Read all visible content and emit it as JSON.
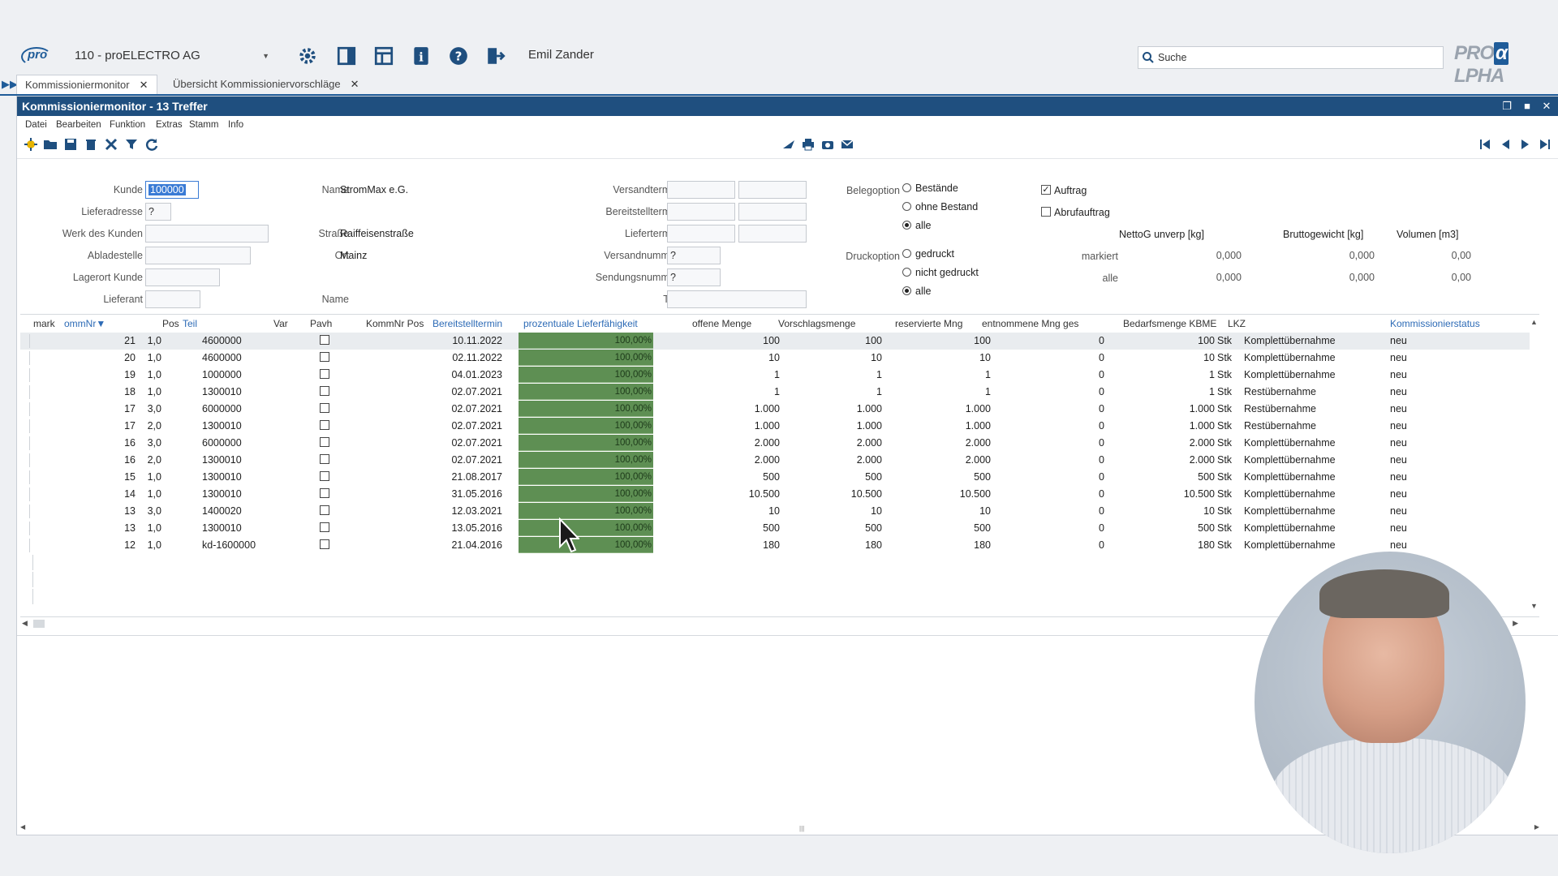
{
  "company": "110 - proELECTRO AG",
  "user": "Emil Zander",
  "search_placeholder": "Suche",
  "brand": {
    "pre": "PRO",
    "alpha": "α",
    "post": "LPHA"
  },
  "tabs": [
    {
      "label": "Kommissioniermonitor"
    },
    {
      "label": "Übersicht Kommissioniervorschläge"
    }
  ],
  "window_title": "Kommissioniermonitor - 13 Treffer",
  "menu": [
    "Datei",
    "Bearbeiten",
    "Funktion",
    "Extras",
    "Stamm",
    "Info"
  ],
  "form": {
    "kunde_label": "Kunde",
    "kunde_value": "100000",
    "lieferadresse_label": "Lieferadresse",
    "lieferadresse_value": "?",
    "werk_label": "Werk des Kunden",
    "abladestelle_label": "Abladestelle",
    "lagerort_label": "Lagerort Kunde",
    "lieferant_label": "Lieferant",
    "name_label": "Name",
    "name_value": "StromMax e.G.",
    "strasse_label": "Straße",
    "strasse_value": "Raiffeisenstraße",
    "ort_label": "Ort",
    "ort_value": "Mainz",
    "name2_label": "Name",
    "versandtermin_label": "Versandtermin",
    "bereitstelltermin_label": "Bereitstelltermin",
    "liefertermin_label": "Liefertermin",
    "versandnummer_label": "Versandnummer",
    "versandnummer_value": "?",
    "sendungsnummer_label": "Sendungsnummer",
    "sendungsnummer_value": "?",
    "teil_label": "Teil",
    "belegoption_label": "Belegoption",
    "belegoptions": [
      "Bestände",
      "ohne Bestand",
      "alle"
    ],
    "druckoption_label": "Druckoption",
    "druckoptions": [
      "gedruckt",
      "nicht gedruckt",
      "alle"
    ],
    "auftrag_label": "Auftrag",
    "abrufauftrag_label": "Abrufauftrag",
    "summary_headers": [
      "NettoG unverp [kg]",
      "Bruttogewicht [kg]",
      "Volumen [m3]"
    ],
    "summary_rows": [
      {
        "label": "markiert",
        "values": [
          "0,000",
          "0,000",
          "0,00"
        ]
      },
      {
        "label": "alle",
        "values": [
          "0,000",
          "0,000",
          "0,00"
        ]
      }
    ]
  },
  "table": {
    "headers": {
      "mark": "mark",
      "nr": "ommNr",
      "pos": "Pos",
      "teil": "Teil",
      "var": "Var",
      "pavh": "Pavh",
      "kommpos": "KommNr Pos",
      "bereit": "Bereitstelltermin",
      "liefer": "prozentuale Lieferfähigkeit",
      "offen": "offene Menge",
      "vorschlag": "Vorschlagsmenge",
      "reserviert": "reservierte Mng",
      "entnommen": "entnommene Mng ges",
      "bedarf": "Bedarfsmenge KBME",
      "lkz": "LKZ",
      "status": "Kommissionierstatus"
    },
    "rows": [
      {
        "nr": "21",
        "pos": "1,0",
        "teil": "4600000",
        "date": "10.11.2022",
        "pct": "100,00%",
        "offen": "100",
        "vor": "100",
        "res": "100",
        "ent": "0",
        "bed": "100",
        "unit": "Stk",
        "lkz": "Komplettübernahme",
        "status": "neu"
      },
      {
        "nr": "20",
        "pos": "1,0",
        "teil": "4600000",
        "date": "02.11.2022",
        "pct": "100,00%",
        "offen": "10",
        "vor": "10",
        "res": "10",
        "ent": "0",
        "bed": "10",
        "unit": "Stk",
        "lkz": "Komplettübernahme",
        "status": "neu"
      },
      {
        "nr": "19",
        "pos": "1,0",
        "teil": "1000000",
        "date": "04.01.2023",
        "pct": "100,00%",
        "offen": "1",
        "vor": "1",
        "res": "1",
        "ent": "0",
        "bed": "1",
        "unit": "Stk",
        "lkz": "Komplettübernahme",
        "status": "neu"
      },
      {
        "nr": "18",
        "pos": "1,0",
        "teil": "1300010",
        "date": "02.07.2021",
        "pct": "100,00%",
        "offen": "1",
        "vor": "1",
        "res": "1",
        "ent": "0",
        "bed": "1",
        "unit": "Stk",
        "lkz": "Restübernahme",
        "status": "neu"
      },
      {
        "nr": "17",
        "pos": "3,0",
        "teil": "6000000",
        "date": "02.07.2021",
        "pct": "100,00%",
        "offen": "1.000",
        "vor": "1.000",
        "res": "1.000",
        "ent": "0",
        "bed": "1.000",
        "unit": "Stk",
        "lkz": "Restübernahme",
        "status": "neu"
      },
      {
        "nr": "17",
        "pos": "2,0",
        "teil": "1300010",
        "date": "02.07.2021",
        "pct": "100,00%",
        "offen": "1.000",
        "vor": "1.000",
        "res": "1.000",
        "ent": "0",
        "bed": "1.000",
        "unit": "Stk",
        "lkz": "Restübernahme",
        "status": "neu"
      },
      {
        "nr": "16",
        "pos": "3,0",
        "teil": "6000000",
        "date": "02.07.2021",
        "pct": "100,00%",
        "offen": "2.000",
        "vor": "2.000",
        "res": "2.000",
        "ent": "0",
        "bed": "2.000",
        "unit": "Stk",
        "lkz": "Komplettübernahme",
        "status": "neu"
      },
      {
        "nr": "16",
        "pos": "2,0",
        "teil": "1300010",
        "date": "02.07.2021",
        "pct": "100,00%",
        "offen": "2.000",
        "vor": "2.000",
        "res": "2.000",
        "ent": "0",
        "bed": "2.000",
        "unit": "Stk",
        "lkz": "Komplettübernahme",
        "status": "neu"
      },
      {
        "nr": "15",
        "pos": "1,0",
        "teil": "1300010",
        "date": "21.08.2017",
        "pct": "100,00%",
        "offen": "500",
        "vor": "500",
        "res": "500",
        "ent": "0",
        "bed": "500",
        "unit": "Stk",
        "lkz": "Komplettübernahme",
        "status": "neu"
      },
      {
        "nr": "14",
        "pos": "1,0",
        "teil": "1300010",
        "date": "31.05.2016",
        "pct": "100,00%",
        "offen": "10.500",
        "vor": "10.500",
        "res": "10.500",
        "ent": "0",
        "bed": "10.500",
        "unit": "Stk",
        "lkz": "Komplettübernahme",
        "status": "neu"
      },
      {
        "nr": "13",
        "pos": "3,0",
        "teil": "1400020",
        "date": "12.03.2021",
        "pct": "100,00%",
        "offen": "10",
        "vor": "10",
        "res": "10",
        "ent": "0",
        "bed": "10",
        "unit": "Stk",
        "lkz": "Komplettübernahme",
        "status": "neu"
      },
      {
        "nr": "13",
        "pos": "1,0",
        "teil": "1300010",
        "date": "13.05.2016",
        "pct": "100,00%",
        "offen": "500",
        "vor": "500",
        "res": "500",
        "ent": "0",
        "bed": "500",
        "unit": "Stk",
        "lkz": "Komplettübernahme",
        "status": "neu"
      },
      {
        "nr": "12",
        "pos": "1,0",
        "teil": "kd-1600000",
        "date": "21.04.2016",
        "pct": "100,00%",
        "offen": "180",
        "vor": "180",
        "res": "180",
        "ent": "0",
        "bed": "180",
        "unit": "Stk",
        "lkz": "Komplettübernahme",
        "status": "neu"
      }
    ]
  },
  "colors": {
    "accent": "#1f4f7f",
    "bar": "#5e8f53",
    "link": "#2d6bb6"
  }
}
